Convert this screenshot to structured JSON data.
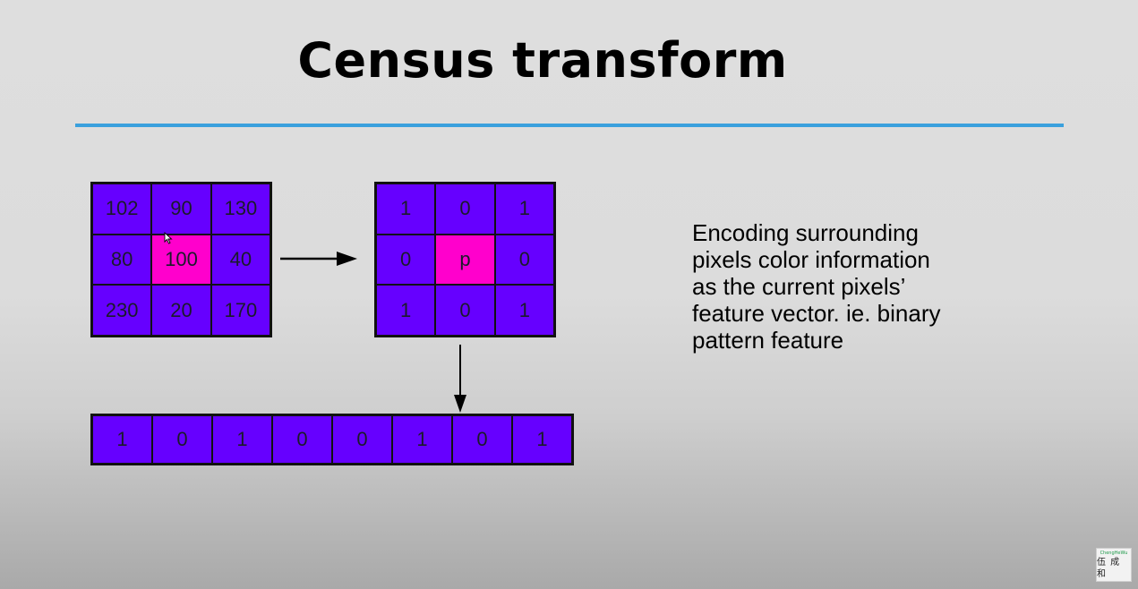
{
  "slide": {
    "title": "Census transform",
    "accent_color": "#3aa0dd"
  },
  "diagram": {
    "input_grid": [
      "102",
      "90",
      "130",
      "80",
      "100",
      "40",
      "230",
      "20",
      "170"
    ],
    "binary_grid": [
      "1",
      "0",
      "1",
      "0",
      "p",
      "0",
      "1",
      "0",
      "1"
    ],
    "feature_vector": [
      "1",
      "0",
      "1",
      "0",
      "0",
      "1",
      "0",
      "1"
    ],
    "center_index": 4,
    "cell_color": "#6600ff",
    "center_color": "#ff00cc"
  },
  "description": {
    "lines": [
      "Encoding surrounding",
      "pixels color information",
      "as the current pixels’",
      "feature vector. ie. binary",
      "pattern feature"
    ]
  },
  "watermark": {
    "top": "ChengHeWu",
    "bottom": "伍 成 和"
  },
  "icons": {
    "cursor": "mouse-pointer-icon",
    "right_arrow": "arrow-right-icon",
    "down_arrow": "arrow-down-icon"
  }
}
